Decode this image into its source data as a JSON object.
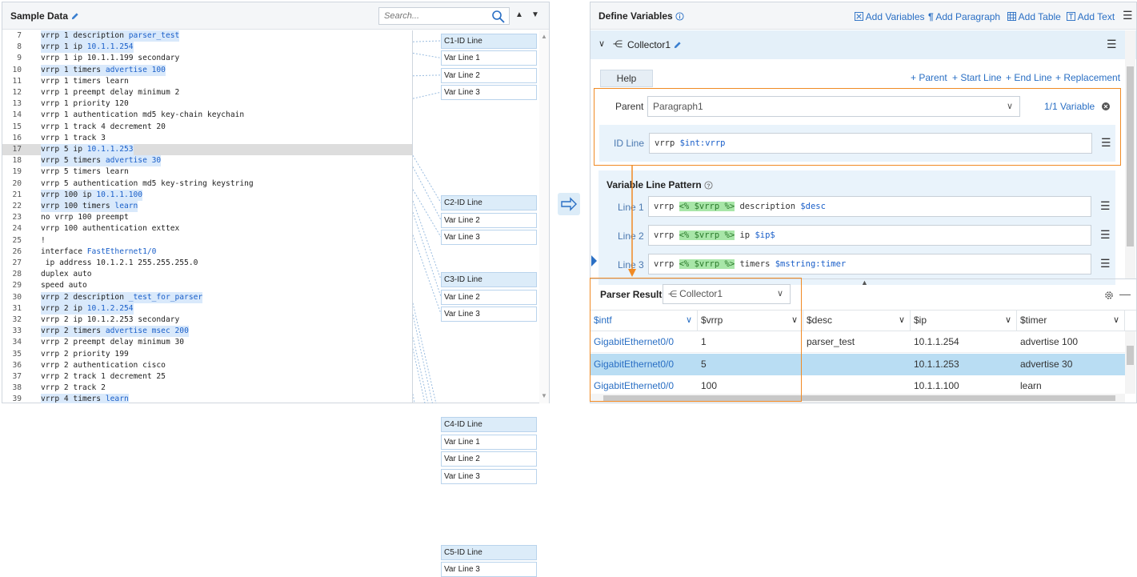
{
  "left_panel": {
    "title": "Sample Data",
    "search_placeholder": "Search...",
    "lines": [
      {
        "num": "7",
        "text": "vrrp 1 description parser_test"
      },
      {
        "num": "8",
        "text": "vrrp 1 ip 10.1.1.254"
      },
      {
        "num": "9",
        "text": "vrrp 1 ip 10.1.1.199 secondary"
      },
      {
        "num": "10",
        "text": "vrrp 1 timers advertise 100"
      },
      {
        "num": "11",
        "text": "vrrp 1 timers learn"
      },
      {
        "num": "12",
        "text": "vrrp 1 preempt delay minimum 2"
      },
      {
        "num": "13",
        "text": "vrrp 1 priority 120"
      },
      {
        "num": "14",
        "text": "vrrp 1 authentication md5 key-chain keychain"
      },
      {
        "num": "15",
        "text": "vrrp 1 track 4 decrement 20"
      },
      {
        "num": "16",
        "text": "vrrp 1 track 3"
      },
      {
        "num": "17",
        "text": "vrrp 5 ip 10.1.1.253"
      },
      {
        "num": "18",
        "text": "vrrp 5 timers advertise 30"
      },
      {
        "num": "19",
        "text": "vrrp 5 timers learn"
      },
      {
        "num": "20",
        "text": "vrrp 5 authentication md5 key-string keystring"
      },
      {
        "num": "21",
        "text": "vrrp 100 ip 10.1.1.100"
      },
      {
        "num": "22",
        "text": "vrrp 100 timers learn"
      },
      {
        "num": "23",
        "text": "no vrrp 100 preempt"
      },
      {
        "num": "24",
        "text": "vrrp 100 authentication exttex"
      },
      {
        "num": "25",
        "text": "!"
      },
      {
        "num": "26",
        "text": "interface FastEthernet1/0"
      },
      {
        "num": "27",
        "text": " ip address 10.1.2.1 255.255.255.0"
      },
      {
        "num": "28",
        "text": "duplex auto"
      },
      {
        "num": "29",
        "text": "speed auto"
      },
      {
        "num": "30",
        "text": "vrrp 2 description _test_for_parser"
      },
      {
        "num": "31",
        "text": "vrrp 2 ip 10.1.2.254"
      },
      {
        "num": "32",
        "text": "vrrp 2 ip 10.1.2.253 secondary"
      },
      {
        "num": "33",
        "text": "vrrp 2 timers advertise msec 200"
      },
      {
        "num": "34",
        "text": "vrrp 2 preempt delay minimum 30"
      },
      {
        "num": "35",
        "text": "vrrp 2 priority 199"
      },
      {
        "num": "36",
        "text": "vrrp 2 authentication cisco"
      },
      {
        "num": "37",
        "text": "vrrp 2 track 1 decrement 25"
      },
      {
        "num": "38",
        "text": "vrrp 2 track 2"
      },
      {
        "num": "39",
        "text": "vrrp 4 timers learn"
      }
    ],
    "tags": [
      "C1-ID Line",
      "Var Line 1",
      "Var Line 2",
      "Var Line 3",
      "C2-ID Line",
      "Var Line 2",
      "Var Line 3",
      "C3-ID Line",
      "Var Line 2",
      "Var Line 3",
      "C4-ID Line",
      "Var Line 1",
      "Var Line 2",
      "Var Line 3",
      "C5-ID Line",
      "Var Line 3"
    ]
  },
  "right_panel": {
    "title": "Define Variables",
    "actions": [
      "Add Variables",
      "Add Paragraph",
      "Add Table",
      "Add Text"
    ],
    "collector_name": "Collector1",
    "help_label": "Help",
    "links": [
      "+ Parent",
      "+ Start Line",
      "+ End Line",
      "+ Replacement"
    ],
    "parent_label": "Parent",
    "parent_value": "Paragraph1",
    "variable_count": "1/1 Variable",
    "id_line_label": "ID Line",
    "id_line_plain": "vrrp ",
    "id_line_var": "$int:vrrp",
    "vlp_title": "Variable Line Pattern",
    "pattern_lines": [
      {
        "label": "Line 1",
        "prefix": "vrrp ",
        "tag": "<% $vrrp %>",
        "mid": " description ",
        "var": "$desc",
        "suffix": ""
      },
      {
        "label": "Line 2",
        "prefix": "vrrp ",
        "tag": "<% $vrrp %>",
        "mid": " ip ",
        "var": "$ip",
        "suffix": "$"
      },
      {
        "label": "Line 3",
        "prefix": "vrrp ",
        "tag": "<% $vrrp %>",
        "mid": " timers ",
        "var": "$mstring:timer",
        "suffix": ""
      }
    ],
    "parser_result_label": "Parser Result",
    "parser_collector": "Collector1",
    "columns": [
      "$intf",
      "$vrrp",
      "$desc",
      "$ip",
      "$timer"
    ],
    "rows": [
      [
        "GigabitEthernet0/0",
        "1",
        "parser_test",
        "10.1.1.254",
        "advertise 100"
      ],
      [
        "GigabitEthernet0/0",
        "5",
        "",
        "10.1.1.253",
        "advertise 30"
      ],
      [
        "GigabitEthernet0/0",
        "100",
        "",
        "10.1.1.100",
        "learn"
      ]
    ]
  },
  "colors": {
    "accent": "#2a6fc4",
    "highlight_orange": "#f08a24",
    "selected_row": "#b9ddf3"
  }
}
